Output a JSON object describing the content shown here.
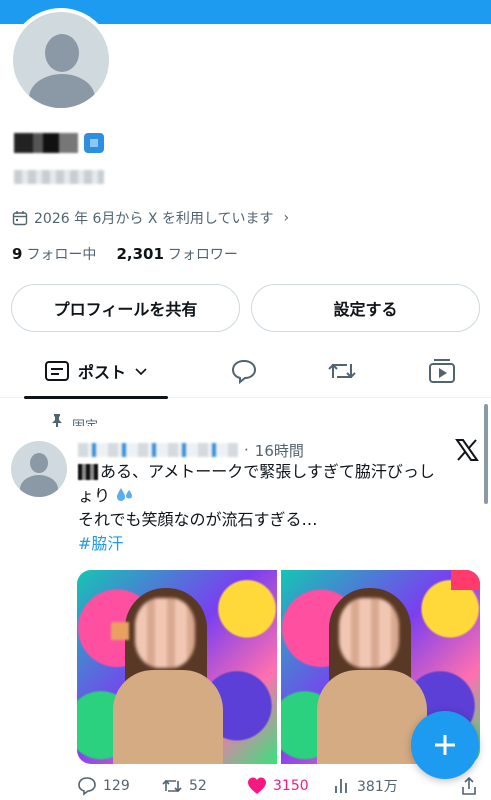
{
  "profile": {
    "joined": "2026 年 6月から X を利用しています",
    "following_count": "9",
    "following_label": "フォロー中",
    "followers_count": "2,301",
    "followers_label": "フォロワー"
  },
  "buttons": {
    "share_profile": "プロフィールを共有",
    "settings": "設定する"
  },
  "tabs": {
    "posts_label": "ポスト"
  },
  "post": {
    "pinned_label": "固定",
    "time": "16時間",
    "text_line1": "ある、アメトーークで緊張しすぎて脇汗びっし",
    "text_line2": "ょり",
    "text_line3": "それでも笑顔なのが流石すぎる…",
    "hashtag": "#脇汗",
    "replies": "129",
    "reposts": "52",
    "likes": "3150",
    "views": "381万"
  },
  "colors": {
    "accent": "#1d9bf0",
    "like": "#f91880",
    "secondary_text": "#536471"
  },
  "icons": [
    "calendar-icon",
    "chevron-right-icon",
    "chevron-down-icon",
    "posts-icon",
    "reply-icon",
    "repost-icon",
    "media-icon",
    "pin-icon",
    "x-logo-icon",
    "sweat-drops-icon",
    "heart-icon",
    "views-icon",
    "share-icon",
    "plus-icon"
  ]
}
